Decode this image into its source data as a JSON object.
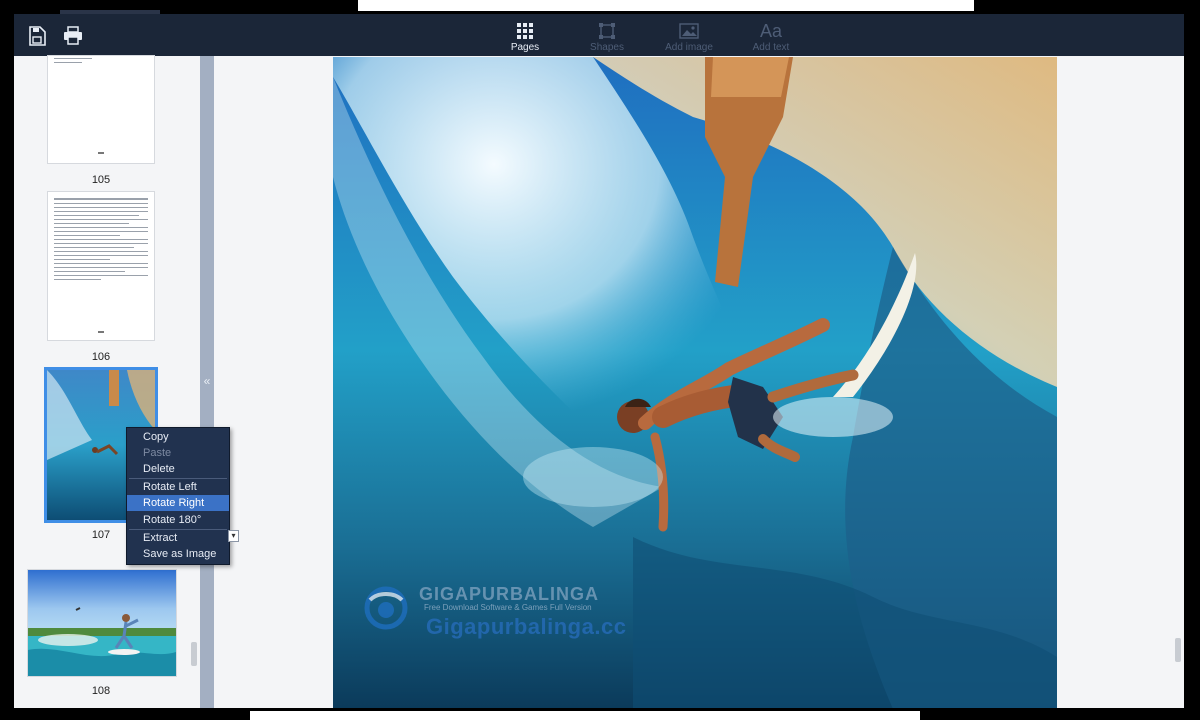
{
  "toolbar": {
    "left_icons": [
      "save-icon",
      "print-icon"
    ],
    "buttons": [
      {
        "label": "Pages",
        "icon": "grid-icon",
        "active": true
      },
      {
        "label": "Shapes",
        "icon": "shapes-icon",
        "active": false
      },
      {
        "label": "Add image",
        "icon": "image-icon",
        "active": false
      },
      {
        "label": "Add text",
        "icon": "text-icon",
        "glyph": "Aa",
        "active": false
      }
    ]
  },
  "sidebar": {
    "pages": [
      "105",
      "106",
      "107",
      "108"
    ],
    "selected_page": "107"
  },
  "context_menu": {
    "items": [
      {
        "label": "Copy",
        "state": "normal"
      },
      {
        "label": "Paste",
        "state": "disabled"
      },
      {
        "label": "Delete",
        "state": "normal"
      },
      {
        "label": "Rotate Left",
        "state": "normal"
      },
      {
        "label": "Rotate Right",
        "state": "highlighted"
      },
      {
        "label": "Rotate 180°",
        "state": "normal"
      },
      {
        "label": "Extract",
        "state": "normal"
      },
      {
        "label": "Save as Image",
        "state": "normal"
      }
    ]
  },
  "watermark": {
    "brand": "GIGAPURBALINGA",
    "tagline": "Free Download Software & Games Full Version",
    "url": "Gigapurbalinga.cc"
  },
  "colors": {
    "toolbar_bg": "#1b2638",
    "menu_bg": "#21324f",
    "menu_highlight": "#3b72c6",
    "selection": "#3f8ee6"
  }
}
